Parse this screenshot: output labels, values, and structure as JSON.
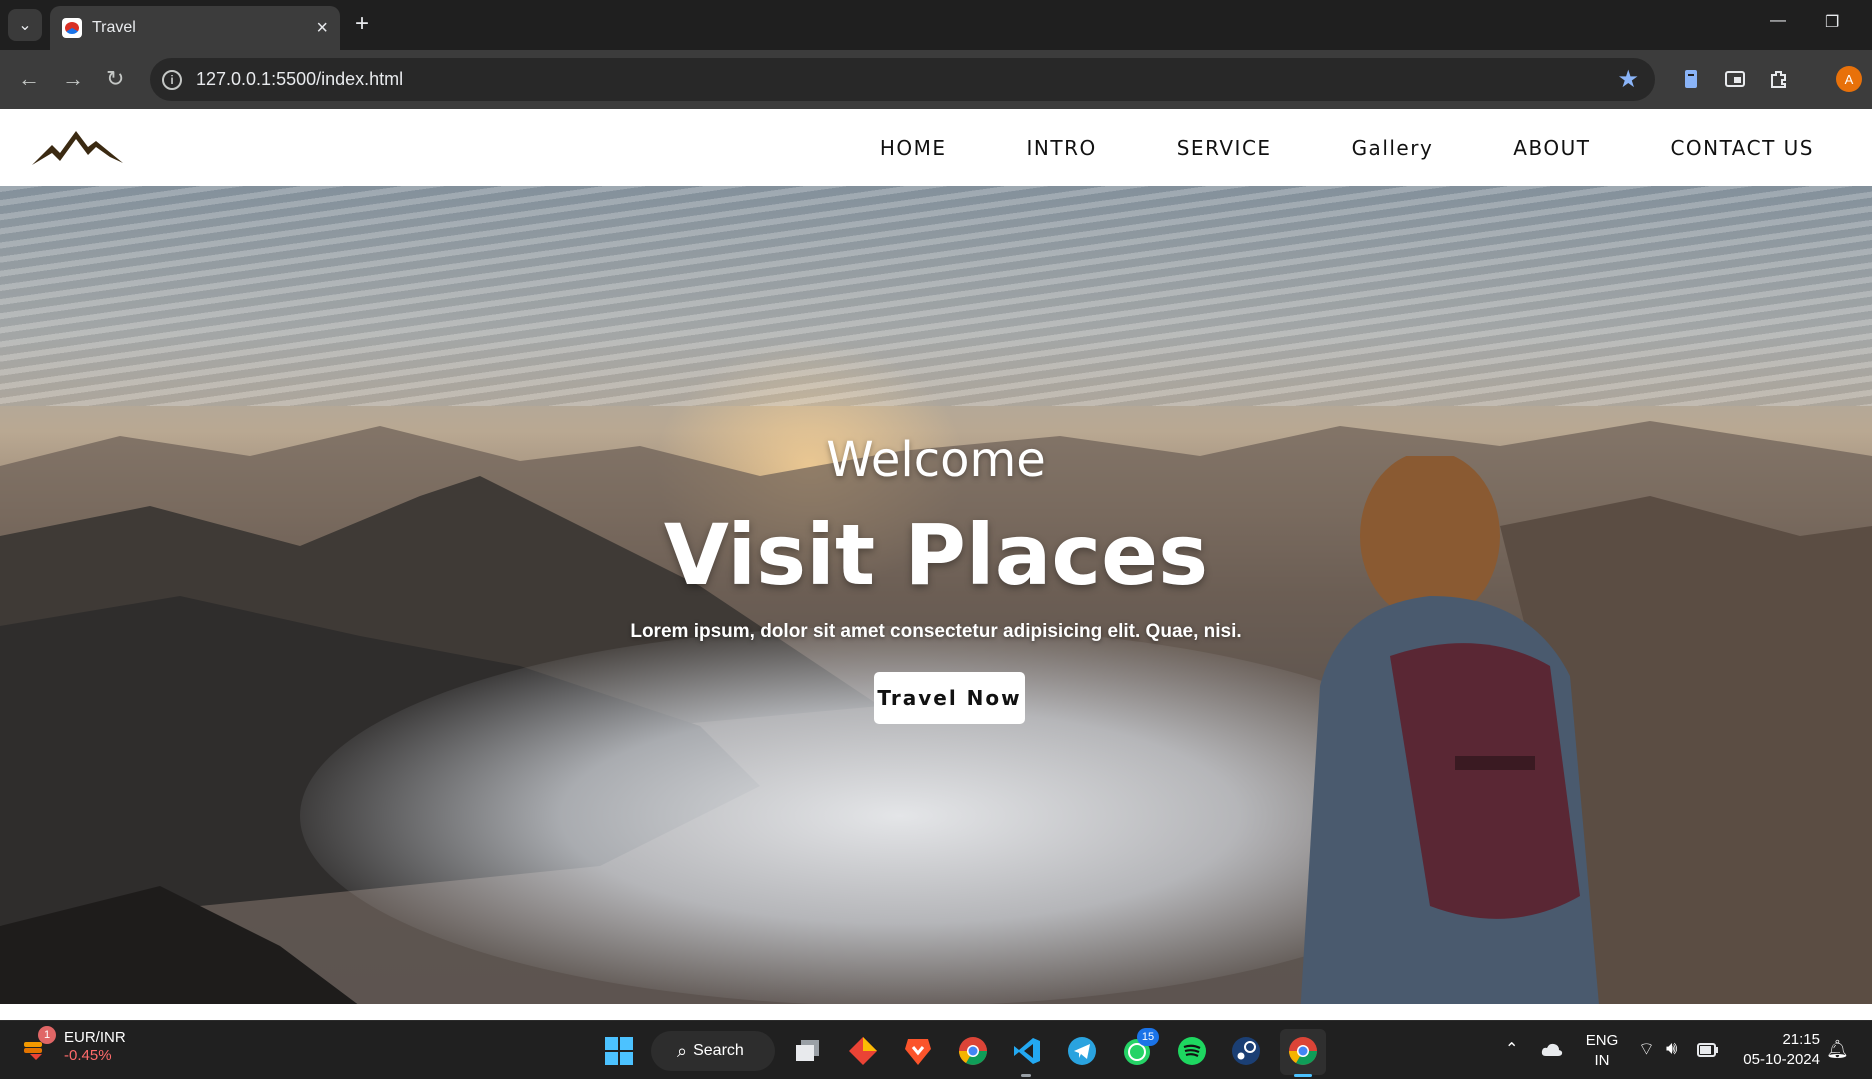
{
  "browser": {
    "tab_title": "Travel",
    "url": "127.0.0.1:5500/index.html",
    "profile_initial": "A"
  },
  "site": {
    "nav": [
      "HOME",
      "INTRO",
      "SERVICE",
      "Gallery",
      "ABOUT",
      "CONTACT US"
    ],
    "hero": {
      "welcome": "Welcome",
      "title": "Visit Places",
      "subtitle": "Lorem ipsum, dolor sit amet consectetur adipisicing elit. Quae, nisi.",
      "cta": "Travel Now"
    }
  },
  "taskbar": {
    "widget_title": "EUR/INR",
    "widget_value": "-0.45%",
    "widget_badge": "1",
    "search_label": "Search",
    "whatsapp_badge": "15",
    "lang_top": "ENG",
    "lang_bottom": "IN",
    "time": "21:15",
    "date": "05-10-2024"
  }
}
